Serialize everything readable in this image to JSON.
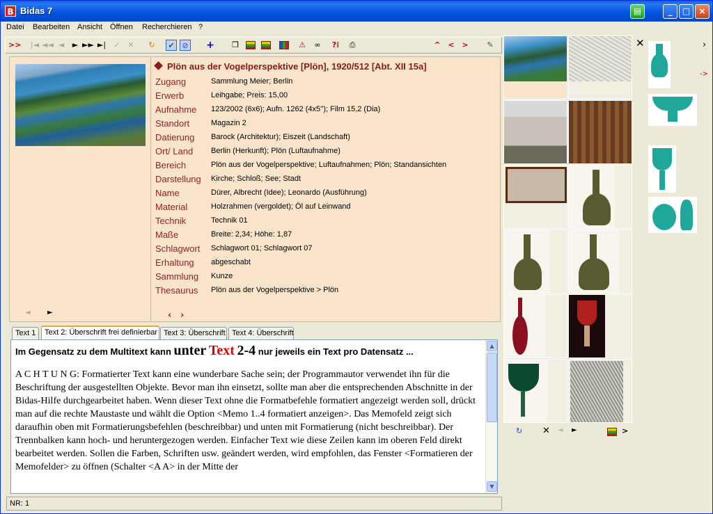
{
  "window": {
    "title": "Bidas 7",
    "app_icon": "B"
  },
  "title_buttons": {
    "minimize": "_",
    "maximize": "□",
    "close": "×"
  },
  "menu": [
    "Datei",
    "Bearbeiten",
    "Ansicht",
    "Öffnen",
    "Recherchieren",
    "?"
  ],
  "toolbar": {
    "first": ">>",
    "nav_up": "^",
    "nav_prev": "<",
    "nav_next": ">"
  },
  "record": {
    "title": "Plön aus der Vogelperspektive [Plön], 1920/512  [Abt. XII 15a]",
    "fields": [
      {
        "label": "Zugang",
        "value": "Sammlung Meier; Berlin"
      },
      {
        "label": "Erwerb",
        "value": "Leihgabe; Preis: 15,00"
      },
      {
        "label": "Aufnahme",
        "value": "123/2002 (6x6); Aufn. 1262 (4x5''); Film 15,2 (Dia)"
      },
      {
        "label": "Standort",
        "value": "Magazin 2"
      },
      {
        "label": "Datierung",
        "value": "Barock (Architektur); Eiszeit (Landschaft)"
      },
      {
        "label": "Ort/ Land",
        "value": "Berlin (Herkunft); Plön (Luftaufnahme)"
      },
      {
        "label": "Bereich",
        "value": "Plön aus der Vogelperspektive; Luftaufnahmen; Plön; Standansichten"
      },
      {
        "label": "Darstellung",
        "value": "Kirche; Schloß; See; Stadt"
      },
      {
        "label": "Name",
        "value": "Dürer, Albrecht (Idee); Leonardo (Ausführung)"
      },
      {
        "label": "Material",
        "value": "Holzrahmen (vergoldet); Öl auf Leinwand"
      },
      {
        "label": "Technik",
        "value": "Technik 01"
      },
      {
        "label": "Maße",
        "value": "Breite: 2,34; Höhe: 1,87"
      },
      {
        "label": "Schlagwort",
        "value": "Schlagwort 01; Schlagwort 07"
      },
      {
        "label": "Erhaltung",
        "value": "abgeschabt"
      },
      {
        "label": "Sammlung",
        "value": "Kunze"
      },
      {
        "label": "Thesaurus",
        "value": "Plön aus der Vogelperspektive > Plön"
      }
    ],
    "field_nav": {
      "prev": "‹",
      "next": "›"
    },
    "image_nav": {
      "prev": "◄",
      "next": "►"
    }
  },
  "tabs": [
    "Text 1",
    "Text 2: Überschrift frei definierbar",
    "Text 3: Überschrift",
    "Text 4: Überschrift"
  ],
  "memo": {
    "head_a": "Im Gegensatz zu dem Multitext kann ",
    "head_b": "unter",
    "head_c": "Text",
    "head_d": "2-4",
    "head_e": " nur jeweils ein Text pro Datensatz ...",
    "body": "A C H T U N G: Formatierter Text kann eine wunderbare Sache sein; der Programmautor verwendet ihn für die Beschriftung der ausgestellten Objekte. Bevor man ihn einsetzt, sollte man aber die entsprechenden Abschnitte in der Bidas-Hilfe durchgearbeitet haben. Wenn dieser Text ohne die Formatbefehle formatiert angezeigt werden soll, drückt man auf die rechte Maustaste und wählt die Option <Memo 1..4 formatiert anzeigen>. Das Memofeld zeigt sich daraufhin oben mit Formatierungsbefehlen (beschreibbar) und unten mit Formatierung (nicht beschreibbar). Der Trennbalken kann hoch- und heruntergezogen werden. Einfacher Text wie diese Zeilen kann im oberen Feld direkt bearbeitet werden. Sollen die Farben, Schriften usw. geändert werden, wird empfohlen, das Fenster <Formatieren der Memofelder> zu öffnen (Schalter <A A> in der Mitte der"
  },
  "status": {
    "text": "NR: 1"
  },
  "gallery_nav": {
    "close": "✕",
    "prev": "◄",
    "next": "►",
    "more": ">"
  },
  "side": {
    "close": "✕",
    "arrow": "->",
    "more": "›"
  }
}
